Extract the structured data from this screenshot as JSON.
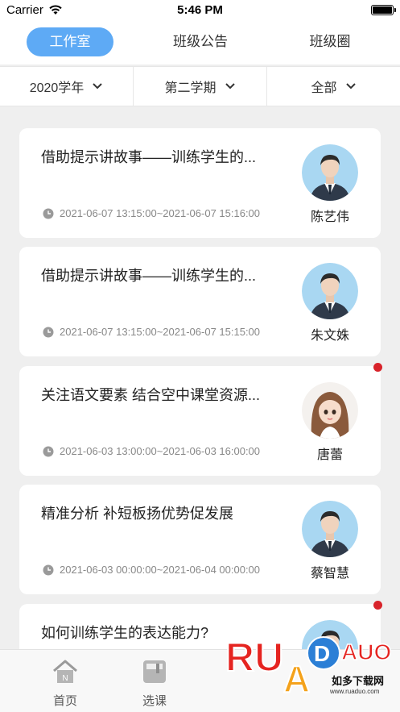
{
  "status_bar": {
    "carrier": "Carrier",
    "time": "5:46 PM"
  },
  "top_tabs": [
    {
      "label": "工作室",
      "active": true
    },
    {
      "label": "班级公告",
      "active": false
    },
    {
      "label": "班级圈",
      "active": false
    }
  ],
  "filters": [
    {
      "label": "2020学年"
    },
    {
      "label": "第二学期"
    },
    {
      "label": "全部"
    }
  ],
  "cards": [
    {
      "title": "借助提示讲故事——训练学生的...",
      "time_range": "2021-06-07 13:15:00~2021-06-07 15:16:00",
      "person": "陈艺伟",
      "avatar": "male-avatar",
      "unread": false
    },
    {
      "title": "借助提示讲故事——训练学生的...",
      "time_range": "2021-06-07 13:15:00~2021-06-07 15:15:00",
      "person": "朱文姝",
      "avatar": "male-avatar",
      "unread": false
    },
    {
      "title": "关注语文要素 结合空中课堂资源...",
      "time_range": "2021-06-03 13:00:00~2021-06-03 16:00:00",
      "person": "唐蕾",
      "avatar": "female-avatar",
      "unread": true
    },
    {
      "title": "精准分析  补短板扬优势促发展",
      "time_range": "2021-06-03 00:00:00~2021-06-04 00:00:00",
      "person": "蔡智慧",
      "avatar": "male-avatar",
      "unread": false
    },
    {
      "title": "如何训练学生的表达能力?",
      "time_range": "",
      "person": "",
      "avatar": "male-avatar",
      "unread": true
    }
  ],
  "bottom_nav": [
    {
      "label": "首页",
      "icon": "home-icon"
    },
    {
      "label": "选课",
      "icon": "course-icon"
    }
  ],
  "watermark": {
    "brand": "RUANDAO",
    "sub": "如多下载网",
    "url": "www.ruaduo.com"
  },
  "colors": {
    "accent": "#5eaaf5",
    "unread_dot": "#d8232a",
    "background": "#efefef"
  }
}
